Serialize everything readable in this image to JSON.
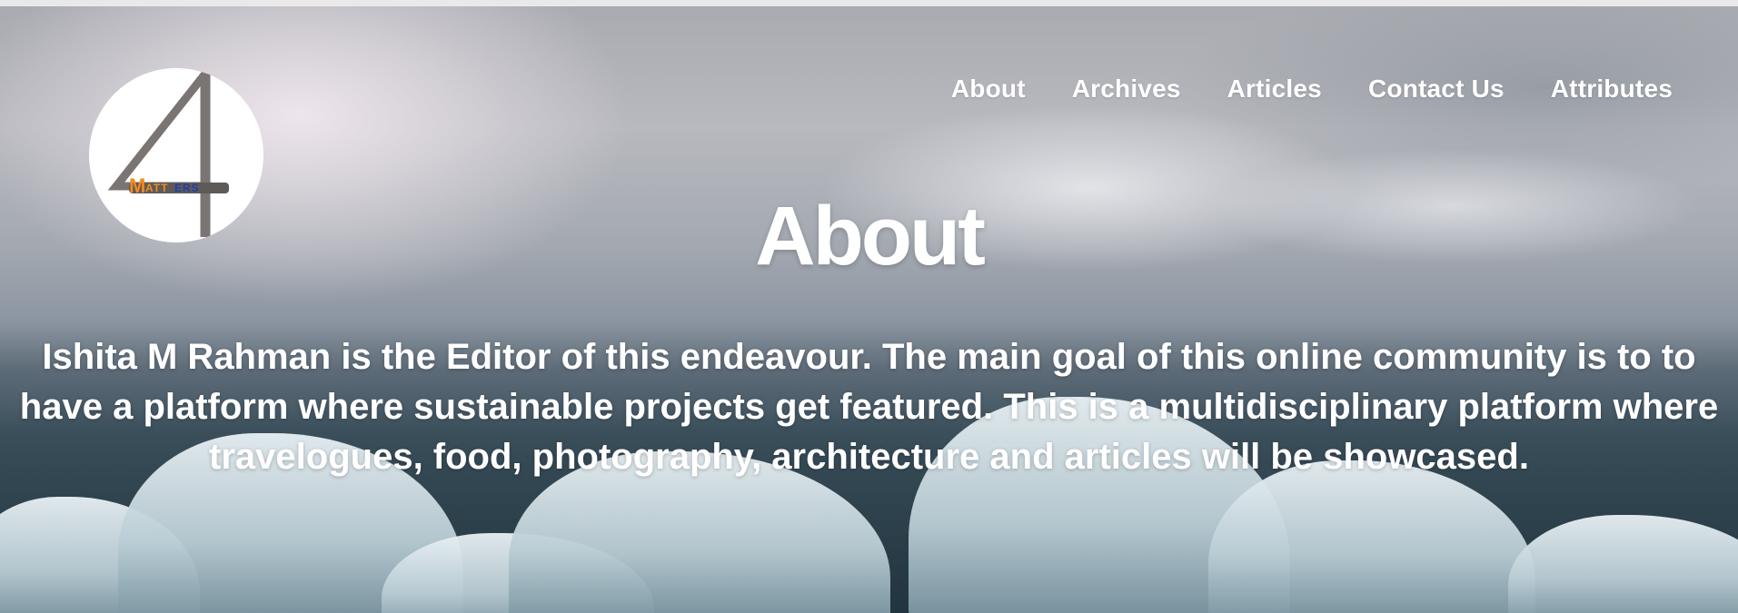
{
  "logo": {
    "numeral": "4",
    "wordmark": "MATTERS"
  },
  "nav": {
    "items": [
      {
        "label": "About"
      },
      {
        "label": "Archives"
      },
      {
        "label": "Articles"
      },
      {
        "label": "Contact Us"
      },
      {
        "label": "Attributes"
      }
    ]
  },
  "hero": {
    "title": "About",
    "description": "Ishita M Rahman is the Editor of this endeavour. The main goal of this online community is to to have a platform where sustainable projects get featured. This is a multidisciplinary platform where travelogues, food, photography, architecture and articles will be showcased."
  },
  "colors": {
    "text": "#ffffff",
    "logo_numeral": "#7a7572",
    "logo_word_orange": "#f28a1e",
    "logo_word_blue": "#1f3fa8"
  }
}
